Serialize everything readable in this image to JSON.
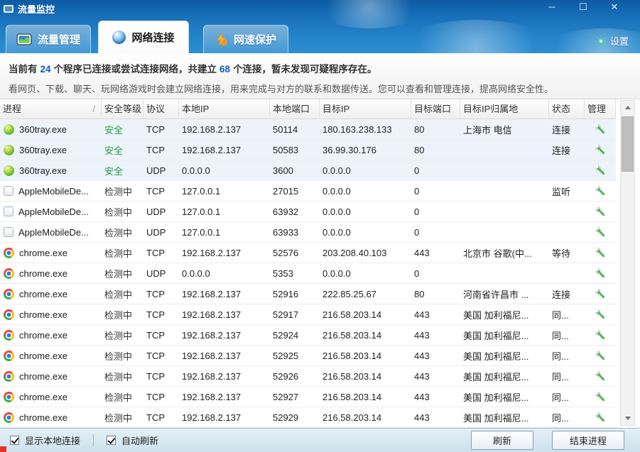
{
  "window": {
    "title": "流量监控",
    "controls": {
      "minimize": "─",
      "maximize": "☐",
      "close": "✕"
    }
  },
  "tabs": [
    {
      "label": "流量管理"
    },
    {
      "label": "网络连接"
    },
    {
      "label": "网速保护"
    }
  ],
  "settings_label": "设置",
  "summary": {
    "part1": "当前有",
    "program_count": "24",
    "part2": "个程序已连接或尝试连接网络，共建立",
    "connection_count": "68",
    "part3": "个连接，暂未发现可疑程序存在。",
    "description": "看网页、下载、聊天、玩网络游戏时会建立网络连接，用来完成与对方的联系和数据传送。您可以查看和管理连接，提高网络安全性。"
  },
  "table": {
    "sort_indicator": "/",
    "columns": [
      "进程",
      "安全等级",
      "协议",
      "本地IP",
      "本地端口",
      "目标IP",
      "目标端口",
      "目标IP归属地",
      "状态",
      "管理"
    ],
    "rows": [
      {
        "icon": "c360",
        "process": "360tray.exe",
        "level": "安全",
        "level_class": "safe",
        "protocol": "TCP",
        "local_ip": "192.168.2.137",
        "local_port": "50114",
        "remote_ip": "180.163.238.133",
        "remote_port": "80",
        "location": "上海市 电信",
        "status": "连接",
        "tinted": true
      },
      {
        "icon": "c360",
        "process": "360tray.exe",
        "level": "安全",
        "level_class": "safe",
        "protocol": "TCP",
        "local_ip": "192.168.2.137",
        "local_port": "50583",
        "remote_ip": "36.99.30.176",
        "remote_port": "80",
        "location": "",
        "status": "连接",
        "tinted": true
      },
      {
        "icon": "c360",
        "process": "360tray.exe",
        "level": "安全",
        "level_class": "safe",
        "protocol": "UDP",
        "local_ip": "0.0.0.0",
        "local_port": "3600",
        "remote_ip": "0.0.0.0",
        "remote_port": "0",
        "location": "",
        "status": "",
        "tinted": true
      },
      {
        "icon": "apple",
        "process": "AppleMobileDe...",
        "level": "检测中",
        "level_class": "checking",
        "protocol": "TCP",
        "local_ip": "127.0.0.1",
        "local_port": "27015",
        "remote_ip": "0.0.0.0",
        "remote_port": "0",
        "location": "",
        "status": "监听",
        "tinted": false
      },
      {
        "icon": "apple",
        "process": "AppleMobileDe...",
        "level": "检测中",
        "level_class": "checking",
        "protocol": "UDP",
        "local_ip": "127.0.0.1",
        "local_port": "63932",
        "remote_ip": "0.0.0.0",
        "remote_port": "0",
        "location": "",
        "status": "",
        "tinted": false
      },
      {
        "icon": "apple",
        "process": "AppleMobileDe...",
        "level": "检测中",
        "level_class": "checking",
        "protocol": "UDP",
        "local_ip": "127.0.0.1",
        "local_port": "63933",
        "remote_ip": "0.0.0.0",
        "remote_port": "0",
        "location": "",
        "status": "",
        "tinted": false
      },
      {
        "icon": "chrome",
        "process": "chrome.exe",
        "level": "检测中",
        "level_class": "checking",
        "protocol": "TCP",
        "local_ip": "192.168.2.137",
        "local_port": "52576",
        "remote_ip": "203.208.40.103",
        "remote_port": "443",
        "location": "北京市 谷歌(中...",
        "status": "等待",
        "tinted": false
      },
      {
        "icon": "chrome",
        "process": "chrome.exe",
        "level": "检测中",
        "level_class": "checking",
        "protocol": "UDP",
        "local_ip": "0.0.0.0",
        "local_port": "5353",
        "remote_ip": "0.0.0.0",
        "remote_port": "0",
        "location": "",
        "status": "",
        "tinted": false
      },
      {
        "icon": "chrome",
        "process": "chrome.exe",
        "level": "检测中",
        "level_class": "checking",
        "protocol": "TCP",
        "local_ip": "192.168.2.137",
        "local_port": "52916",
        "remote_ip": "222.85.25.67",
        "remote_port": "80",
        "location": "河南省许昌市 ...",
        "status": "连接",
        "tinted": false
      },
      {
        "icon": "chrome",
        "process": "chrome.exe",
        "level": "检测中",
        "level_class": "checking",
        "protocol": "TCP",
        "local_ip": "192.168.2.137",
        "local_port": "52917",
        "remote_ip": "216.58.203.14",
        "remote_port": "443",
        "location": "美国 加利福尼...",
        "status": "同...",
        "tinted": false
      },
      {
        "icon": "chrome",
        "process": "chrome.exe",
        "level": "检测中",
        "level_class": "checking",
        "protocol": "TCP",
        "local_ip": "192.168.2.137",
        "local_port": "52924",
        "remote_ip": "216.58.203.14",
        "remote_port": "443",
        "location": "美国 加利福尼...",
        "status": "同...",
        "tinted": false
      },
      {
        "icon": "chrome",
        "process": "chrome.exe",
        "level": "检测中",
        "level_class": "checking",
        "protocol": "TCP",
        "local_ip": "192.168.2.137",
        "local_port": "52925",
        "remote_ip": "216.58.203.14",
        "remote_port": "443",
        "location": "美国 加利福尼...",
        "status": "同...",
        "tinted": false
      },
      {
        "icon": "chrome",
        "process": "chrome.exe",
        "level": "检测中",
        "level_class": "checking",
        "protocol": "TCP",
        "local_ip": "192.168.2.137",
        "local_port": "52926",
        "remote_ip": "216.58.203.14",
        "remote_port": "443",
        "location": "美国 加利福尼...",
        "status": "同...",
        "tinted": false
      },
      {
        "icon": "chrome",
        "process": "chrome.exe",
        "level": "检测中",
        "level_class": "checking",
        "protocol": "TCP",
        "local_ip": "192.168.2.137",
        "local_port": "52927",
        "remote_ip": "216.58.203.14",
        "remote_port": "443",
        "location": "美国 加利福尼...",
        "status": "同...",
        "tinted": false
      },
      {
        "icon": "chrome",
        "process": "chrome.exe",
        "level": "检测中",
        "level_class": "checking",
        "protocol": "TCP",
        "local_ip": "192.168.2.137",
        "local_port": "52929",
        "remote_ip": "216.58.203.14",
        "remote_port": "443",
        "location": "美国 加利福尼...",
        "status": "同...",
        "tinted": false
      }
    ]
  },
  "footer": {
    "show_local_label": "显示本地连接",
    "auto_refresh_label": "自动刷新",
    "refresh_button": "刷新",
    "end_process_button": "结束进程"
  },
  "colors": {
    "titlebar_blue": "#176fb8",
    "number_blue": "#0c5fc4",
    "safe_green": "#1f9c40",
    "wrench_green": "#5fb55f"
  }
}
